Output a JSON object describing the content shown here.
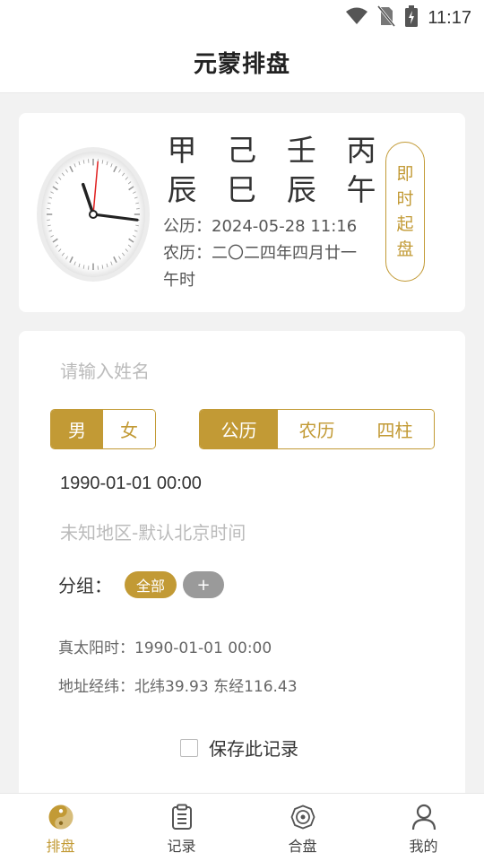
{
  "status_bar": {
    "time": "11:17",
    "icons": [
      "wifi-icon",
      "no-sim-icon",
      "battery-charging-icon"
    ]
  },
  "header": {
    "title": "元蒙排盘"
  },
  "top_card": {
    "pillars_stems": [
      "甲",
      "己",
      "壬",
      "丙"
    ],
    "pillars_branches": [
      "辰",
      "巳",
      "辰",
      "午"
    ],
    "gregorian_label": "公历：",
    "gregorian_value": "2024-05-28 11:16",
    "lunar_label": "农历：",
    "lunar_value": "二〇二四年四月廿一",
    "lunar_hour": "午时",
    "instant_button_chars": [
      "即",
      "时",
      "起",
      "盘"
    ],
    "clock": {
      "hour": 11,
      "minute": 16,
      "second": 1
    }
  },
  "form": {
    "name_placeholder": "请输入姓名",
    "name_value": "",
    "gender_options": [
      "男",
      "女"
    ],
    "gender_selected": "男",
    "calendar_options": [
      "公历",
      "农历",
      "四柱"
    ],
    "calendar_selected": "公历",
    "birth_datetime": "1990-01-01 00:00",
    "region_placeholder": "未知地区-默认北京时间",
    "group_label": "分组：",
    "group_tags": [
      "全部",
      "+"
    ],
    "true_solar_label": "真太阳时：",
    "true_solar_value": "1990-01-01 00:00",
    "coords_label": "地址经纬：",
    "coords_value": "北纬39.93 东经116.43",
    "save_label": "保存此记录",
    "save_checked": false
  },
  "bottom_nav": {
    "items": [
      {
        "label": "排盘",
        "icon": "yin-yang-icon",
        "active": true
      },
      {
        "label": "记录",
        "icon": "clipboard-icon",
        "active": false
      },
      {
        "label": "合盘",
        "icon": "compass-icon",
        "active": false
      },
      {
        "label": "我的",
        "icon": "user-icon",
        "active": false
      }
    ]
  },
  "colors": {
    "accent": "#c29a35",
    "muted_tag": "#9a9a9a",
    "background": "#f2f2f2"
  }
}
